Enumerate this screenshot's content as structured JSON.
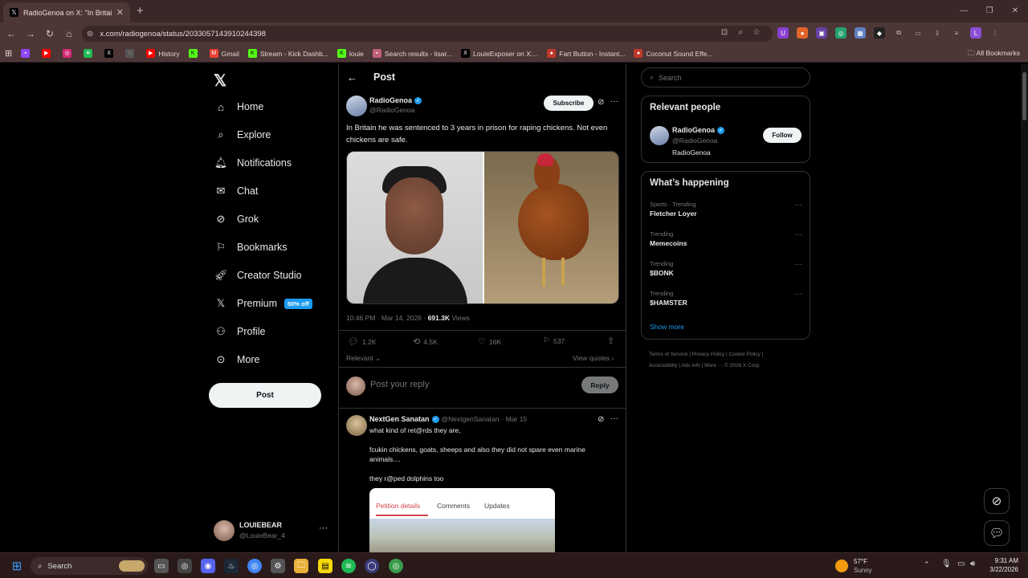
{
  "browser": {
    "tab_title": "RadioGenoa on X: \"In Britain he",
    "url": "x.com/radiogenoa/status/2033057143910244398",
    "bookmarks": [
      "History",
      "Gmail",
      "Stream - Kick Dashb...",
      "louie",
      "Search results - lisar...",
      "LouieExposer on X:...",
      "Fart Button - Instant...",
      "Coconut Sound Effe..."
    ],
    "all_bookmarks": "All Bookmarks"
  },
  "nav": {
    "items": [
      "Home",
      "Explore",
      "Notifications",
      "Chat",
      "Grok",
      "Bookmarks",
      "Creator Studio",
      "Premium",
      "Profile",
      "More"
    ],
    "premium_badge": "50% off",
    "post_button": "Post"
  },
  "account": {
    "name": "LOUIEBEAR",
    "handle": "@LouieBear_4"
  },
  "header": {
    "title": "Post"
  },
  "post": {
    "author": "RadioGenoa",
    "handle": "@RadioGenoa",
    "subscribe": "Subscribe",
    "text": "In Britain he was sentenced to 3 years in prison for raping chickens. Not even chickens are safe.",
    "time": "10:46 PM · Mar 14, 2026 · ",
    "views_count": "691.3K",
    "views_label": " Views",
    "stats": {
      "replies": "1.2K",
      "reposts": "4.5K",
      "likes": "16K",
      "bookmarks": "537"
    },
    "relevant": "Relevant",
    "view_quotes": "View quotes"
  },
  "reply_box": {
    "placeholder": "Post your reply",
    "button": "Reply"
  },
  "reply": {
    "author": "NextGen Sanatan",
    "handle": "@NextgenSanatan",
    "date": "· Mar 15",
    "line1": "what kind of ret@rds they are,",
    "line2": "fcukin chickens, goats, sheeps and also they did not spare even marine animals....",
    "line3": "they r@ped dolphins too",
    "card_tabs": [
      "Petition details",
      "Comments",
      "Updates"
    ]
  },
  "right": {
    "search_placeholder": "Search",
    "relevant_title": "Relevant people",
    "person": {
      "name": "RadioGenoa",
      "handle": "@RadioGenoa",
      "bio": "RadioGenoa",
      "follow": "Follow"
    },
    "happening_title": "What’s happening",
    "trends": [
      {
        "category": "Sports · Trending",
        "name": "Fletcher Loyer"
      },
      {
        "category": "Trending",
        "name": "Memecoins"
      },
      {
        "category": "Trending",
        "name": "$BONK"
      },
      {
        "category": "Trending",
        "name": "$HAMSTER"
      }
    ],
    "show_more": "Show more",
    "footer_line1": "Terms of Service  |  Privacy Policy  |  Cookie Policy  |",
    "footer_line2": "Accessibility  |  Ads info  |  More ···   © 2026 X Corp."
  },
  "taskbar": {
    "search": "Search",
    "weather_temp": "57°F",
    "weather_desc": "Sunny",
    "time": "9:31 AM",
    "date": "3/22/2026"
  },
  "colors": {
    "accent": "#1d9bf0",
    "background": "#000000",
    "chrome": "#4d3636"
  }
}
